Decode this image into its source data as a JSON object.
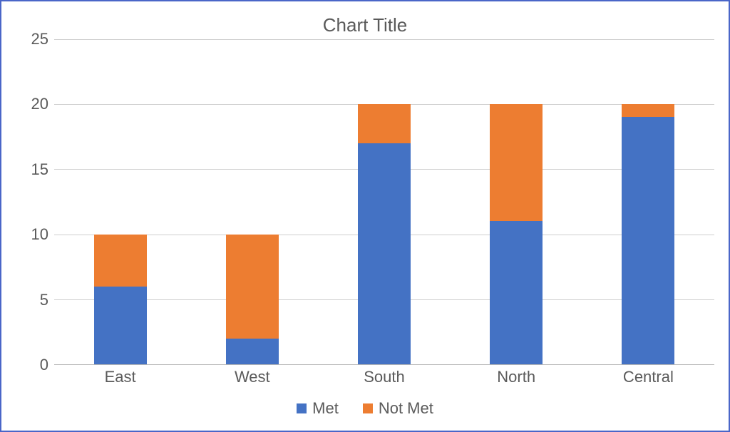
{
  "chart_data": {
    "type": "bar",
    "stacked": true,
    "title": "Chart Title",
    "xlabel": "",
    "ylabel": "",
    "ylim": [
      0,
      25
    ],
    "yticks": [
      0,
      5,
      10,
      15,
      20,
      25
    ],
    "categories": [
      "East",
      "West",
      "South",
      "North",
      "Central"
    ],
    "series": [
      {
        "name": "Met",
        "color": "#4472c4",
        "values": [
          6,
          2,
          17,
          11,
          19
        ]
      },
      {
        "name": "Not Met",
        "color": "#ed7d31",
        "values": [
          4,
          8,
          3,
          9,
          1
        ]
      }
    ],
    "legend_position": "bottom",
    "grid": true
  }
}
